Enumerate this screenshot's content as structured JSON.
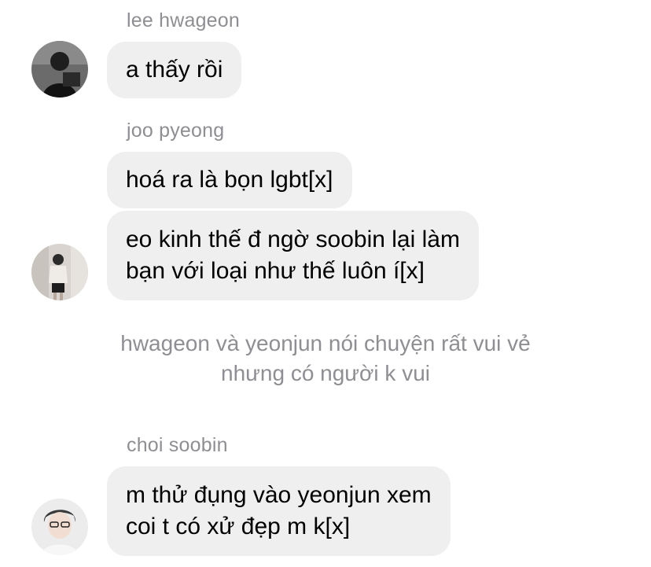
{
  "messages": [
    {
      "sender": "lee hwageon",
      "avatar_icon": "profile-photo-dark-hair",
      "bubbles": [
        {
          "lines": [
            "a thấy rồi"
          ]
        }
      ]
    },
    {
      "sender": "joo pyeong",
      "avatar_icon": "profile-photo-girl-mirror",
      "bubbles": [
        {
          "lines": [
            "hoá ra là bọn lgbt[x]"
          ]
        },
        {
          "lines": [
            "eo kinh thế đ ngờ soobin lại làm",
            "bạn với loại như thế luôn í[x]"
          ]
        }
      ]
    },
    {
      "sender": "choi soobin",
      "avatar_icon": "profile-photo-boy-glasses",
      "bubbles": [
        {
          "lines": [
            "m thử đụng vào yeonjun xem",
            "coi t có xử đẹp m k[x]"
          ]
        }
      ]
    }
  ],
  "system_notice": {
    "lines": [
      "hwageon và yeonjun nói chuyện rất vui vẻ",
      "nhưng có người k vui"
    ]
  },
  "colors": {
    "bubble_bg": "#efeff0",
    "sender_text": "#8e8e93",
    "message_text": "#000000",
    "system_text": "#8e8e93",
    "background": "#ffffff"
  }
}
